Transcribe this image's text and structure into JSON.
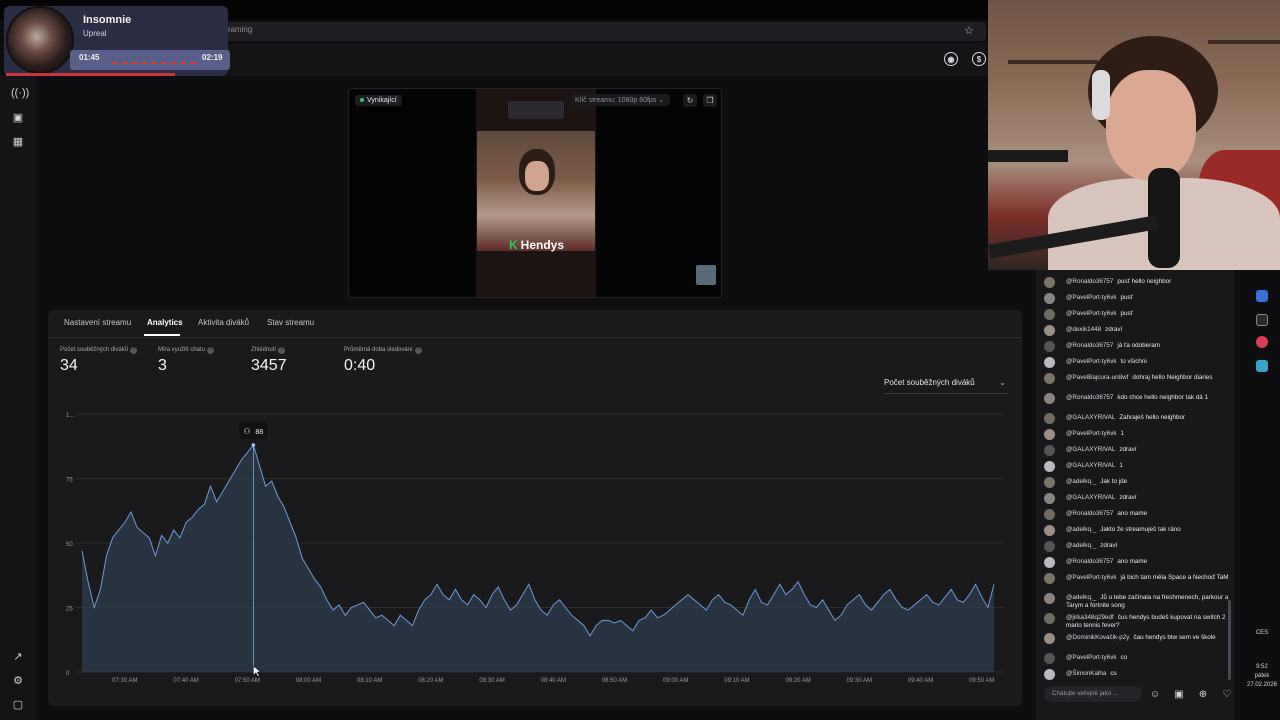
{
  "browser": {
    "url_fragment": "eaming"
  },
  "media": {
    "title": "Insomnie",
    "artist": "Upreal",
    "elapsed": "01:45",
    "total": "02:19",
    "progress": 0.755
  },
  "preview": {
    "live_label": "Vynikající",
    "stream_key_label": "Klíč streamu: 1080p 60fps",
    "streamer_name": "Hendys"
  },
  "tabs": [
    "Nastavení streamu",
    "Analytics",
    "Aktivita diváků",
    "Stav streamu"
  ],
  "active_tab": "Analytics",
  "metrics": [
    {
      "label": "Počet souběžných diváků",
      "value": "34"
    },
    {
      "label": "Míra využití chatu",
      "value": "3"
    },
    {
      "label": "Zhlédnutí",
      "value": "3457"
    },
    {
      "label": "Průměrná doba sledování",
      "value": "0:40"
    }
  ],
  "metric_select": {
    "value": "Počet souběžných diváků"
  },
  "chart_data": {
    "type": "area",
    "tooltip_value": "88",
    "ylim": [
      0,
      100
    ],
    "y_ticks": [
      "0",
      "25",
      "50",
      "75",
      "1..."
    ],
    "x_ticks": [
      "07:30 AM",
      "07:40 AM",
      "07:50 AM",
      "08:00 AM",
      "08:10 AM",
      "08:20 AM",
      "08:30 AM",
      "08:40 AM",
      "08:50 AM",
      "09:00 AM",
      "09:10 AM",
      "09:20 AM",
      "09:30 AM",
      "09:40 AM",
      "09:50 AM"
    ],
    "x_start_min": 443,
    "x_end_min": 592,
    "series": [
      {
        "x": [
          443,
          444,
          445,
          446,
          447,
          448,
          449,
          450,
          451,
          452,
          453,
          454,
          455,
          456,
          457,
          458,
          459,
          460,
          461,
          462,
          463,
          464,
          465,
          466,
          467,
          468,
          469,
          470,
          471,
          472,
          473,
          474,
          475,
          476,
          477,
          478,
          479,
          480,
          481,
          482,
          483,
          484,
          485,
          486,
          487,
          488,
          489,
          490,
          491,
          492,
          493,
          494,
          495,
          496,
          497,
          498,
          499,
          500,
          501,
          502,
          503,
          504,
          505,
          506,
          507,
          508,
          509,
          510,
          511,
          512,
          513,
          514,
          515,
          516,
          517,
          518,
          519,
          520,
          521,
          522,
          523,
          524,
          525,
          526,
          527,
          528,
          529,
          530,
          531,
          532,
          533,
          534,
          535,
          536,
          537,
          538,
          539,
          540,
          541,
          542,
          543,
          544,
          545,
          546,
          547,
          548,
          549,
          550,
          551,
          552,
          553,
          554,
          555,
          556,
          557,
          558,
          559,
          560,
          561,
          562,
          563,
          564,
          565,
          566,
          567,
          568,
          569,
          570,
          571,
          572,
          573,
          574,
          575,
          576,
          577,
          578,
          579,
          580,
          581,
          582,
          583,
          584,
          585,
          586,
          587,
          588,
          589,
          590,
          591,
          592
        ],
        "values": [
          47,
          35,
          25,
          32,
          45,
          52,
          55,
          58,
          62,
          56,
          54,
          52,
          45,
          53,
          50,
          55,
          52,
          58,
          60,
          63,
          65,
          72,
          66,
          70,
          74,
          78,
          82,
          85,
          88,
          80,
          72,
          74,
          68,
          64,
          58,
          52,
          44,
          40,
          36,
          33,
          28,
          24,
          26,
          22,
          25,
          26,
          27,
          24,
          21,
          22,
          20,
          18,
          22,
          20,
          18,
          24,
          28,
          30,
          34,
          30,
          28,
          32,
          28,
          26,
          30,
          28,
          25,
          30,
          33,
          28,
          24,
          26,
          30,
          34,
          28,
          24,
          22,
          26,
          28,
          25,
          22,
          20,
          18,
          14,
          18,
          20,
          20,
          19,
          20,
          18,
          16,
          20,
          21,
          24,
          21,
          22,
          24,
          26,
          28,
          30,
          28,
          26,
          24,
          28,
          30,
          27,
          26,
          24,
          22,
          28,
          32,
          27,
          26,
          30,
          34,
          30,
          32,
          35,
          30,
          26,
          25,
          28,
          24,
          20,
          22,
          26,
          28,
          30,
          26,
          24,
          27,
          30,
          32,
          28,
          25,
          24,
          26,
          28,
          30,
          27,
          26,
          29,
          32,
          28,
          27,
          30,
          34,
          29,
          25,
          34
        ]
      }
    ]
  },
  "chat": {
    "messages": [
      {
        "user": "@Ronaldo36757",
        "text": "pusť hello neighbor"
      },
      {
        "user": "@PavelPort-ty6vk",
        "text": "pusť"
      },
      {
        "user": "@PavelPort-ty6vk",
        "text": "pusť"
      },
      {
        "user": "@dexik1448",
        "text": "zdraví"
      },
      {
        "user": "@Ronaldo36757",
        "text": "já ťa odoberam"
      },
      {
        "user": "@PavelPort-ty6vk",
        "text": "to všichni"
      },
      {
        "user": "@PavelBajcura-un8wf",
        "text": "dohraj hello Neighbor diaries"
      },
      {
        "user": "@Ronaldo36757",
        "text": "kdo chce hello neighbor tak dá 1"
      },
      {
        "user": "@GALAXYRIVAL",
        "text": "Zahraješ hello neighbor"
      },
      {
        "user": "@PavelPort-ty6vk",
        "text": "1"
      },
      {
        "user": "@GALAXYRIVAL",
        "text": "zdraví"
      },
      {
        "user": "@GALAXYRIVAL",
        "text": "1"
      },
      {
        "user": "@adelkq._",
        "text": "Jak to jde"
      },
      {
        "user": "@GALAXYRIVAL",
        "text": "zdraví"
      },
      {
        "user": "@Ronaldo36757",
        "text": "ano mame"
      },
      {
        "user": "@adelkq._",
        "text": "Jakto že streamuješ tak ráno"
      },
      {
        "user": "@adelkq._",
        "text": "zdraví"
      },
      {
        "user": "@Ronaldo36757",
        "text": "ano mame"
      },
      {
        "user": "@PavelPort-ty6vk",
        "text": "já bich tam měla Space a Nechoď TaM"
      },
      {
        "user": "@adelkq._",
        "text": "Jů u tebe začínala na freshmenech, parkour a Tarym a fortnite song"
      },
      {
        "user": "@jirka348q29edf",
        "text": "čus hendys budeš kupovat na switch 2 mario tennis fever?"
      },
      {
        "user": "@DominikKovačik-p2y",
        "text": "čau hendys btw sem ve škole"
      },
      {
        "user": "@PavelPort-ty6vk",
        "text": "co"
      },
      {
        "user": "@ŠimonKalha",
        "text": "cs"
      }
    ],
    "input_placeholder": "Chatujte veřejně jako ..."
  },
  "tray": {
    "lang": "CES",
    "time": "9:52",
    "day": "pátek",
    "date": "27.02.2026"
  },
  "colors": {
    "line": "#6d9bd6",
    "fill": "#2d3c4e",
    "panel": "#1a1a1c",
    "live": "#3ac46a"
  }
}
